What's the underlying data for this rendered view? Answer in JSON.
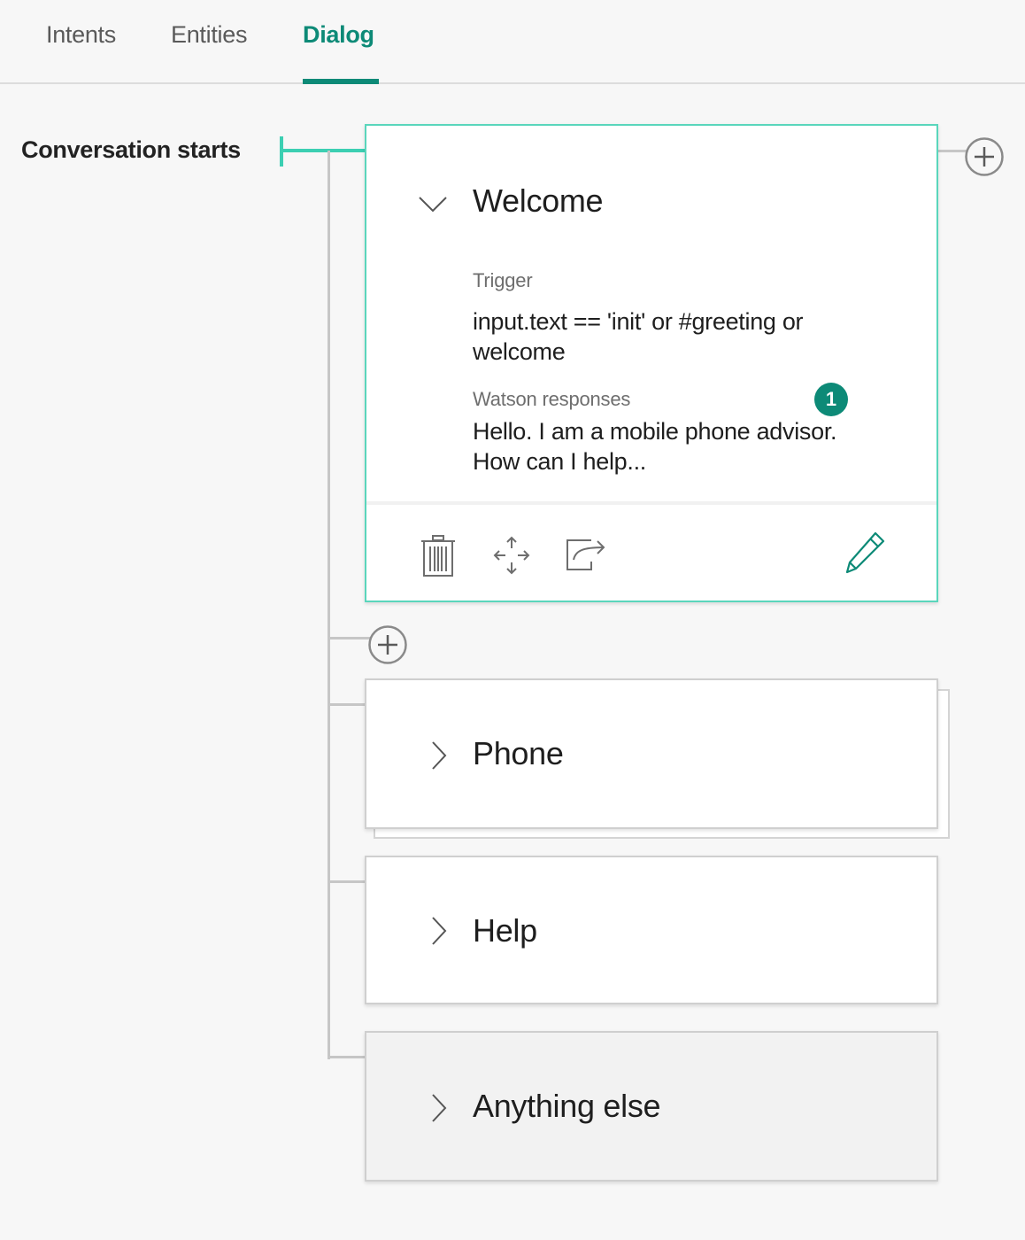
{
  "tabs": [
    {
      "label": "Intents",
      "active": false
    },
    {
      "label": "Entities",
      "active": false
    },
    {
      "label": "Dialog",
      "active": true
    }
  ],
  "tree": {
    "start_label": "Conversation starts"
  },
  "nodes": [
    {
      "title": "Welcome",
      "expanded": true,
      "trigger_label": "Trigger",
      "trigger_value": "input.text == 'init' or #greeting or welcome",
      "responses_label": "Watson responses",
      "responses_count": "1",
      "response_preview": "Hello. I am a mobile phone advisor. How can I help..."
    },
    {
      "title": "Phone",
      "expanded": false
    },
    {
      "title": "Help",
      "expanded": false
    },
    {
      "title": "Anything else",
      "expanded": false
    }
  ],
  "toolbar_icons": [
    "trash-icon",
    "move-icon",
    "jump-to-icon",
    "edit-pencil-icon"
  ],
  "colors": {
    "accent": "#0d8a77",
    "selected_border": "#5ad6bc",
    "tree_line": "#c6c6c6",
    "page_bg": "#f7f7f7"
  }
}
